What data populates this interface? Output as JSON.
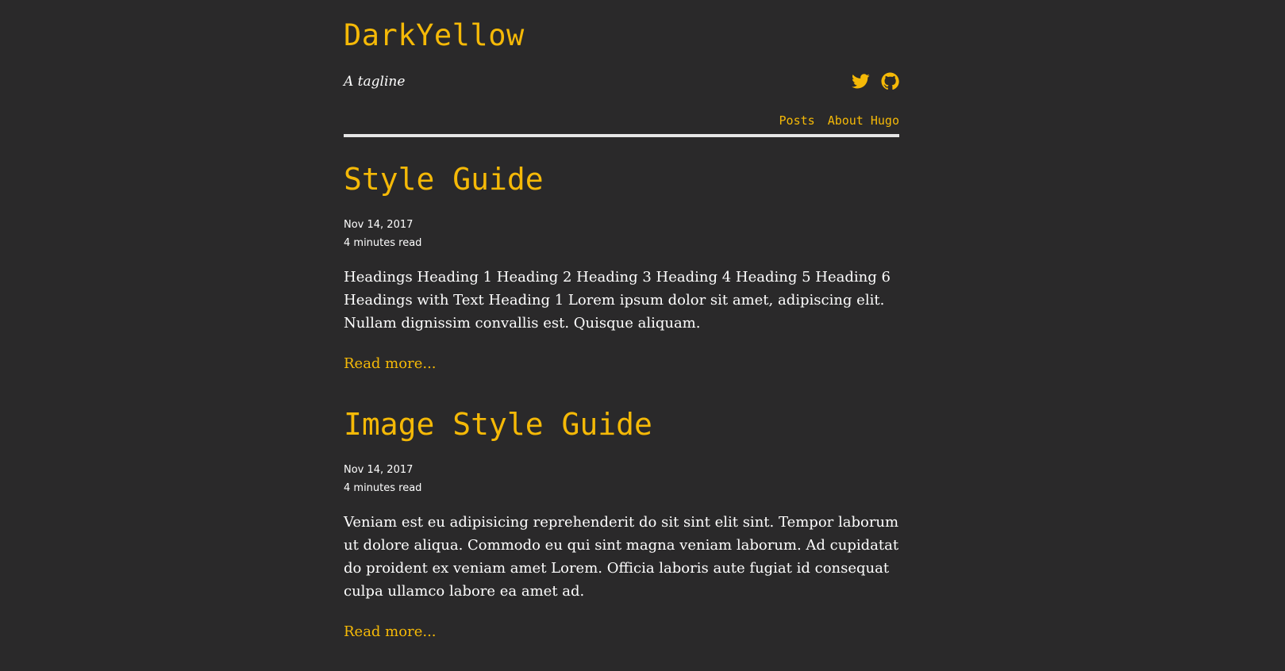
{
  "site": {
    "title": "DarkYellow",
    "tagline": "A tagline"
  },
  "social": [
    {
      "name": "twitter",
      "icon": "twitter-icon"
    },
    {
      "name": "github",
      "icon": "github-icon"
    }
  ],
  "nav": {
    "items": [
      {
        "label": "Posts"
      },
      {
        "label": "About Hugo"
      }
    ]
  },
  "posts": [
    {
      "title": "Style Guide",
      "date": "Nov 14, 2017",
      "read_time": "4 minutes read",
      "summary": "Headings Heading 1 Heading 2 Heading 3 Heading 4 Heading 5 Heading 6 Headings with Text Heading 1 Lorem ipsum dolor sit amet, adipiscing elit. Nullam dignissim convallis est. Quisque aliquam.",
      "read_more": "Read more..."
    },
    {
      "title": "Image Style Guide",
      "date": "Nov 14, 2017",
      "read_time": "4 minutes read",
      "summary": "Veniam est eu adipisicing reprehenderit do sit sint elit sint. Tempor laborum ut dolore aliqua. Commodo eu qui sint magna veniam laborum. Ad cupidatat do proident ex veniam amet Lorem. Officia laboris aute fugiat id consequat culpa ullamco labore ea amet ad.",
      "read_more": "Read more..."
    }
  ],
  "colors": {
    "background": "#2a292a",
    "accent": "#f5b907",
    "text": "#ffffff",
    "rule": "#e6e6e6"
  }
}
